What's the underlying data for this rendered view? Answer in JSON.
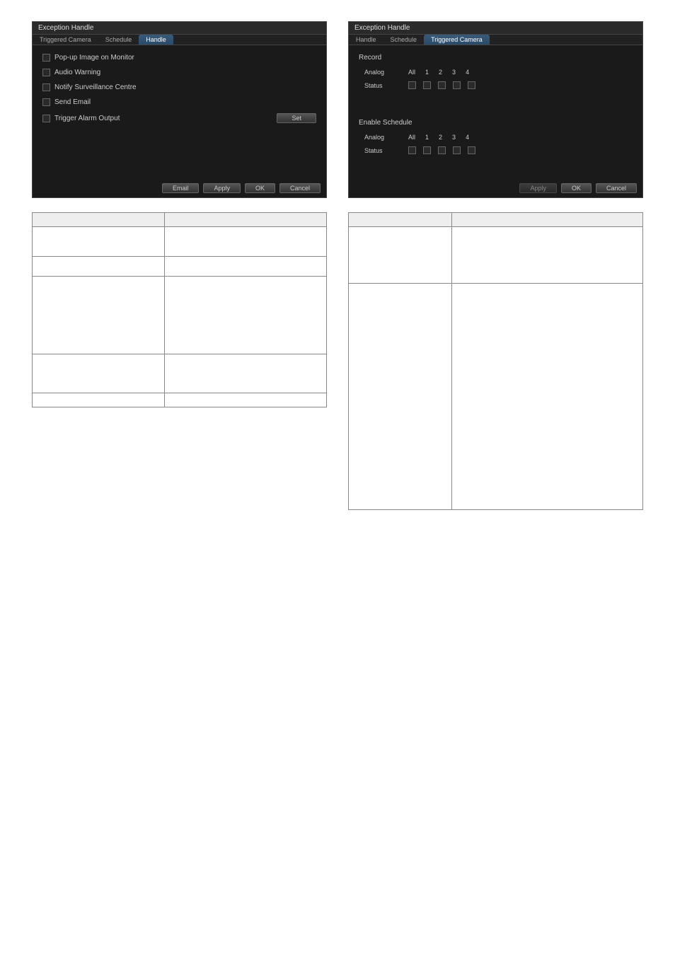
{
  "left_panel": {
    "title": "Exception Handle",
    "tabs": [
      "Triggered Camera",
      "Schedule",
      "Handle"
    ],
    "active_tab": 2,
    "options": [
      "Pop-up Image on Monitor",
      "Audio Warning",
      "Notify Surveillance Centre",
      "Send Email",
      "Trigger Alarm Output"
    ],
    "set_btn": "Set",
    "buttons": [
      "Email",
      "Apply",
      "OK",
      "Cancel"
    ]
  },
  "right_panel": {
    "title": "Exception Handle",
    "tabs": [
      "Handle",
      "Schedule",
      "Triggered Camera"
    ],
    "active_tab": 2,
    "sections": [
      {
        "label": "Record",
        "rows": [
          {
            "label": "Analog",
            "heads": [
              "All",
              "1",
              "2",
              "3",
              "4"
            ]
          },
          {
            "label": "Status",
            "checks": 5
          }
        ]
      },
      {
        "label": "Enable Schedule",
        "rows": [
          {
            "label": "Analog",
            "heads": [
              "All",
              "1",
              "2",
              "3",
              "4"
            ]
          },
          {
            "label": "Status",
            "checks": 5
          }
        ]
      }
    ],
    "buttons": [
      "Apply",
      "OK",
      "Cancel"
    ]
  },
  "left_table": {
    "headers": [
      "",
      ""
    ],
    "rows": [
      {
        "h": "med",
        "c0": "",
        "c1": ""
      },
      {
        "h": "med",
        "c0": "",
        "c1": ""
      },
      {
        "h": "tall",
        "c0": "",
        "c1": ""
      },
      {
        "h": "med",
        "c0": "",
        "c1": ""
      },
      {
        "h": "",
        "c0": "",
        "c1": ""
      }
    ]
  },
  "right_table": {
    "headers": [
      "",
      ""
    ],
    "rows": [
      {
        "h": "tall",
        "c0": "",
        "c1": ""
      },
      {
        "h": "tall",
        "c0": "",
        "c1": "",
        "big": true
      }
    ]
  }
}
